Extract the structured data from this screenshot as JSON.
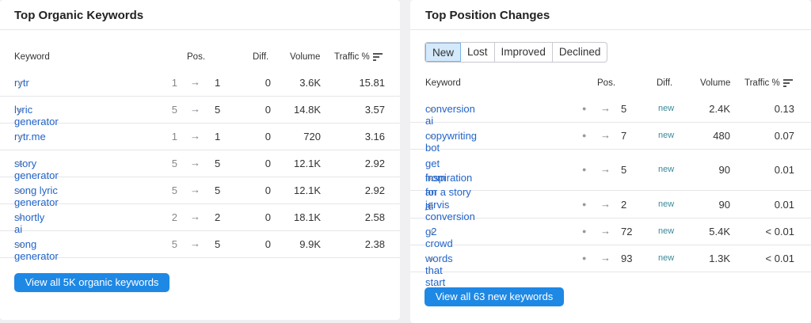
{
  "left": {
    "title": "Top Organic Keywords",
    "columns": {
      "keyword": "Keyword",
      "pos": "Pos.",
      "diff": "Diff.",
      "volume": "Volume",
      "traffic": "Traffic %"
    },
    "rows": [
      {
        "keyword": "rytr",
        "from": "1",
        "to": "1",
        "diff": "0",
        "volume": "3.6K",
        "traffic": "15.81"
      },
      {
        "keyword": "lyric generator",
        "from": "5",
        "to": "5",
        "diff": "0",
        "volume": "14.8K",
        "traffic": "3.57"
      },
      {
        "keyword": "rytr.me",
        "from": "1",
        "to": "1",
        "diff": "0",
        "volume": "720",
        "traffic": "3.16"
      },
      {
        "keyword": "story generator",
        "from": "5",
        "to": "5",
        "diff": "0",
        "volume": "12.1K",
        "traffic": "2.92"
      },
      {
        "keyword": "song lyric generator",
        "from": "5",
        "to": "5",
        "diff": "0",
        "volume": "12.1K",
        "traffic": "2.92"
      },
      {
        "keyword": "shortly ai",
        "from": "2",
        "to": "2",
        "diff": "0",
        "volume": "18.1K",
        "traffic": "2.58"
      },
      {
        "keyword": "song generator",
        "from": "5",
        "to": "5",
        "diff": "0",
        "volume": "9.9K",
        "traffic": "2.38"
      }
    ],
    "button": "View all 5K organic keywords"
  },
  "right": {
    "title": "Top Position Changes",
    "tabs": [
      "New",
      "Lost",
      "Improved",
      "Declined"
    ],
    "active_tab": "New",
    "columns": {
      "keyword": "Keyword",
      "pos": "Pos.",
      "diff": "Diff.",
      "volume": "Volume",
      "traffic": "Traffic %"
    },
    "rows": [
      {
        "keyword": "conversion ai",
        "to": "5",
        "diff": "new",
        "volume": "2.4K",
        "traffic": "0.13"
      },
      {
        "keyword": "copywriting bot",
        "to": "7",
        "diff": "new",
        "volume": "480",
        "traffic": "0.07"
      },
      {
        "keyword": "get inspiration for a story",
        "keyword2": "from an ai",
        "to": "5",
        "diff": "new",
        "volume": "90",
        "traffic": "0.01"
      },
      {
        "keyword": "jarvis conversion",
        "to": "2",
        "diff": "new",
        "volume": "90",
        "traffic": "0.01"
      },
      {
        "keyword": "g2 crowd",
        "to": "72",
        "diff": "new",
        "volume": "5.4K",
        "traffic": "< 0.01"
      },
      {
        "keyword": "words that start sh",
        "to": "93",
        "diff": "new",
        "volume": "1.3K",
        "traffic": "< 0.01"
      }
    ],
    "button": "View all 63 new keywords"
  },
  "icons": {
    "chevron": "double-chevron-right-icon",
    "arrow": "arrow-right-icon",
    "sort": "sort-icon",
    "dot": "dot-icon"
  },
  "colors": {
    "accent": "#1e88e5",
    "link": "#2264c8",
    "active_tab_bg": "#d4e9fb"
  }
}
